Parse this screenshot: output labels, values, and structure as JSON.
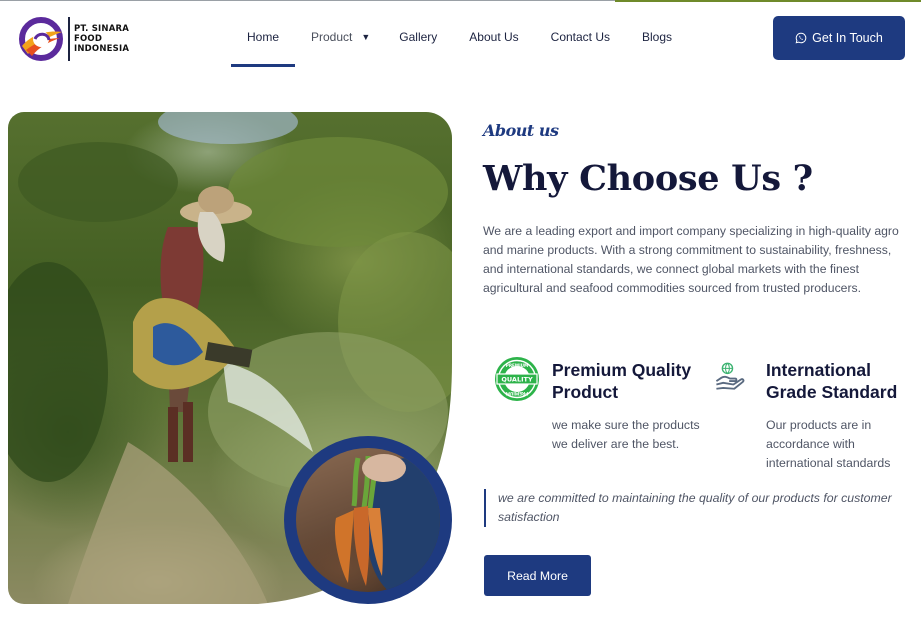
{
  "brand": {
    "name_lines": [
      "PT. SINARA",
      "FOOD",
      "INDONESIA"
    ]
  },
  "nav": {
    "items": [
      {
        "label": "Home"
      },
      {
        "label": "Product"
      },
      {
        "label": "Gallery"
      },
      {
        "label": "About Us"
      },
      {
        "label": "Contact Us"
      },
      {
        "label": "Blogs"
      }
    ],
    "active": "Home"
  },
  "header": {
    "cta_label": "Get In Touch",
    "cta_icon": "whatsapp-icon"
  },
  "about": {
    "kicker": "About us",
    "title": "Why Choose Us ?",
    "lead": "We are a leading export and import company specializing in high-quality agro and marine products. With a strong commitment to sustainability, freshness, and international standards, we connect global markets with the finest agricultural and seafood commodities sourced from trusted producers.",
    "features": [
      {
        "icon": "premium-quality-badge-icon",
        "badge_top": "PREMIUM",
        "badge_middle": "QUALITY",
        "badge_bottom": "PREMIUM",
        "title": "Premium Quality Product",
        "text": "we make sure the products we deliver are the best."
      },
      {
        "icon": "globe-hand-icon",
        "title": "International Grade Standard",
        "text": "Our products are in accordance with international standards"
      }
    ],
    "quote": "we are committed to maintaining the quality of our products for customer satisfaction",
    "read_more_label": "Read More"
  },
  "colors": {
    "primary": "#1e3a80",
    "heading": "#14183a",
    "body_text": "#4f5565",
    "badge_green": "#2db34a"
  }
}
